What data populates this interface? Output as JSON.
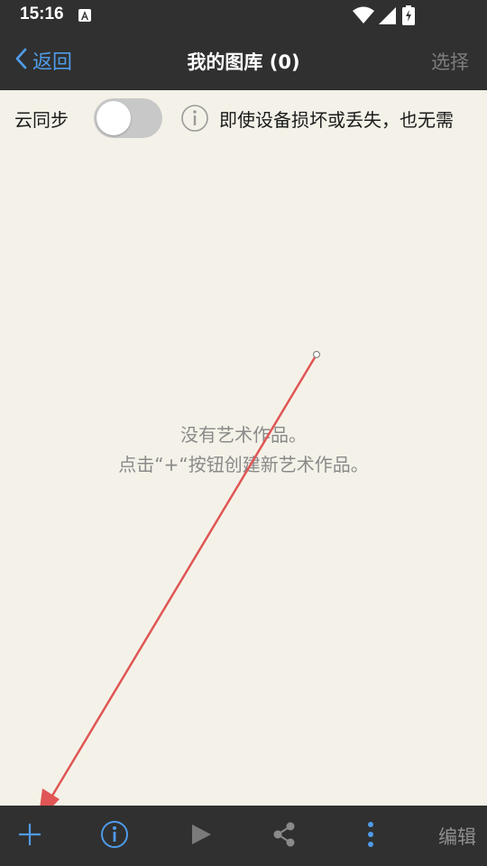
{
  "status_bar": {
    "time": "15:16",
    "icons": [
      "notification-a-icon",
      "wifi-icon",
      "signal-icon",
      "battery-charging-icon"
    ]
  },
  "nav": {
    "back_label": "返回",
    "title": "我的图库 (0)",
    "select_label": "选择"
  },
  "sync": {
    "label": "云同步",
    "enabled": false,
    "description": "即使设备损坏或丢失，也无需"
  },
  "empty_state": {
    "line1": "没有艺术作品。",
    "line2": "点击“+“按钮创建新艺术作品。"
  },
  "toolbar": {
    "icons": [
      "add-icon",
      "info-icon",
      "play-icon",
      "share-icon",
      "more-vertical-icon"
    ],
    "edit_label": "编辑"
  },
  "colors": {
    "bar_background": "#303030",
    "page_background": "#f4f2e8",
    "accent_blue": "#4f9be8",
    "annotation_red": "#e05555",
    "muted_gray": "#8a8a8a"
  }
}
